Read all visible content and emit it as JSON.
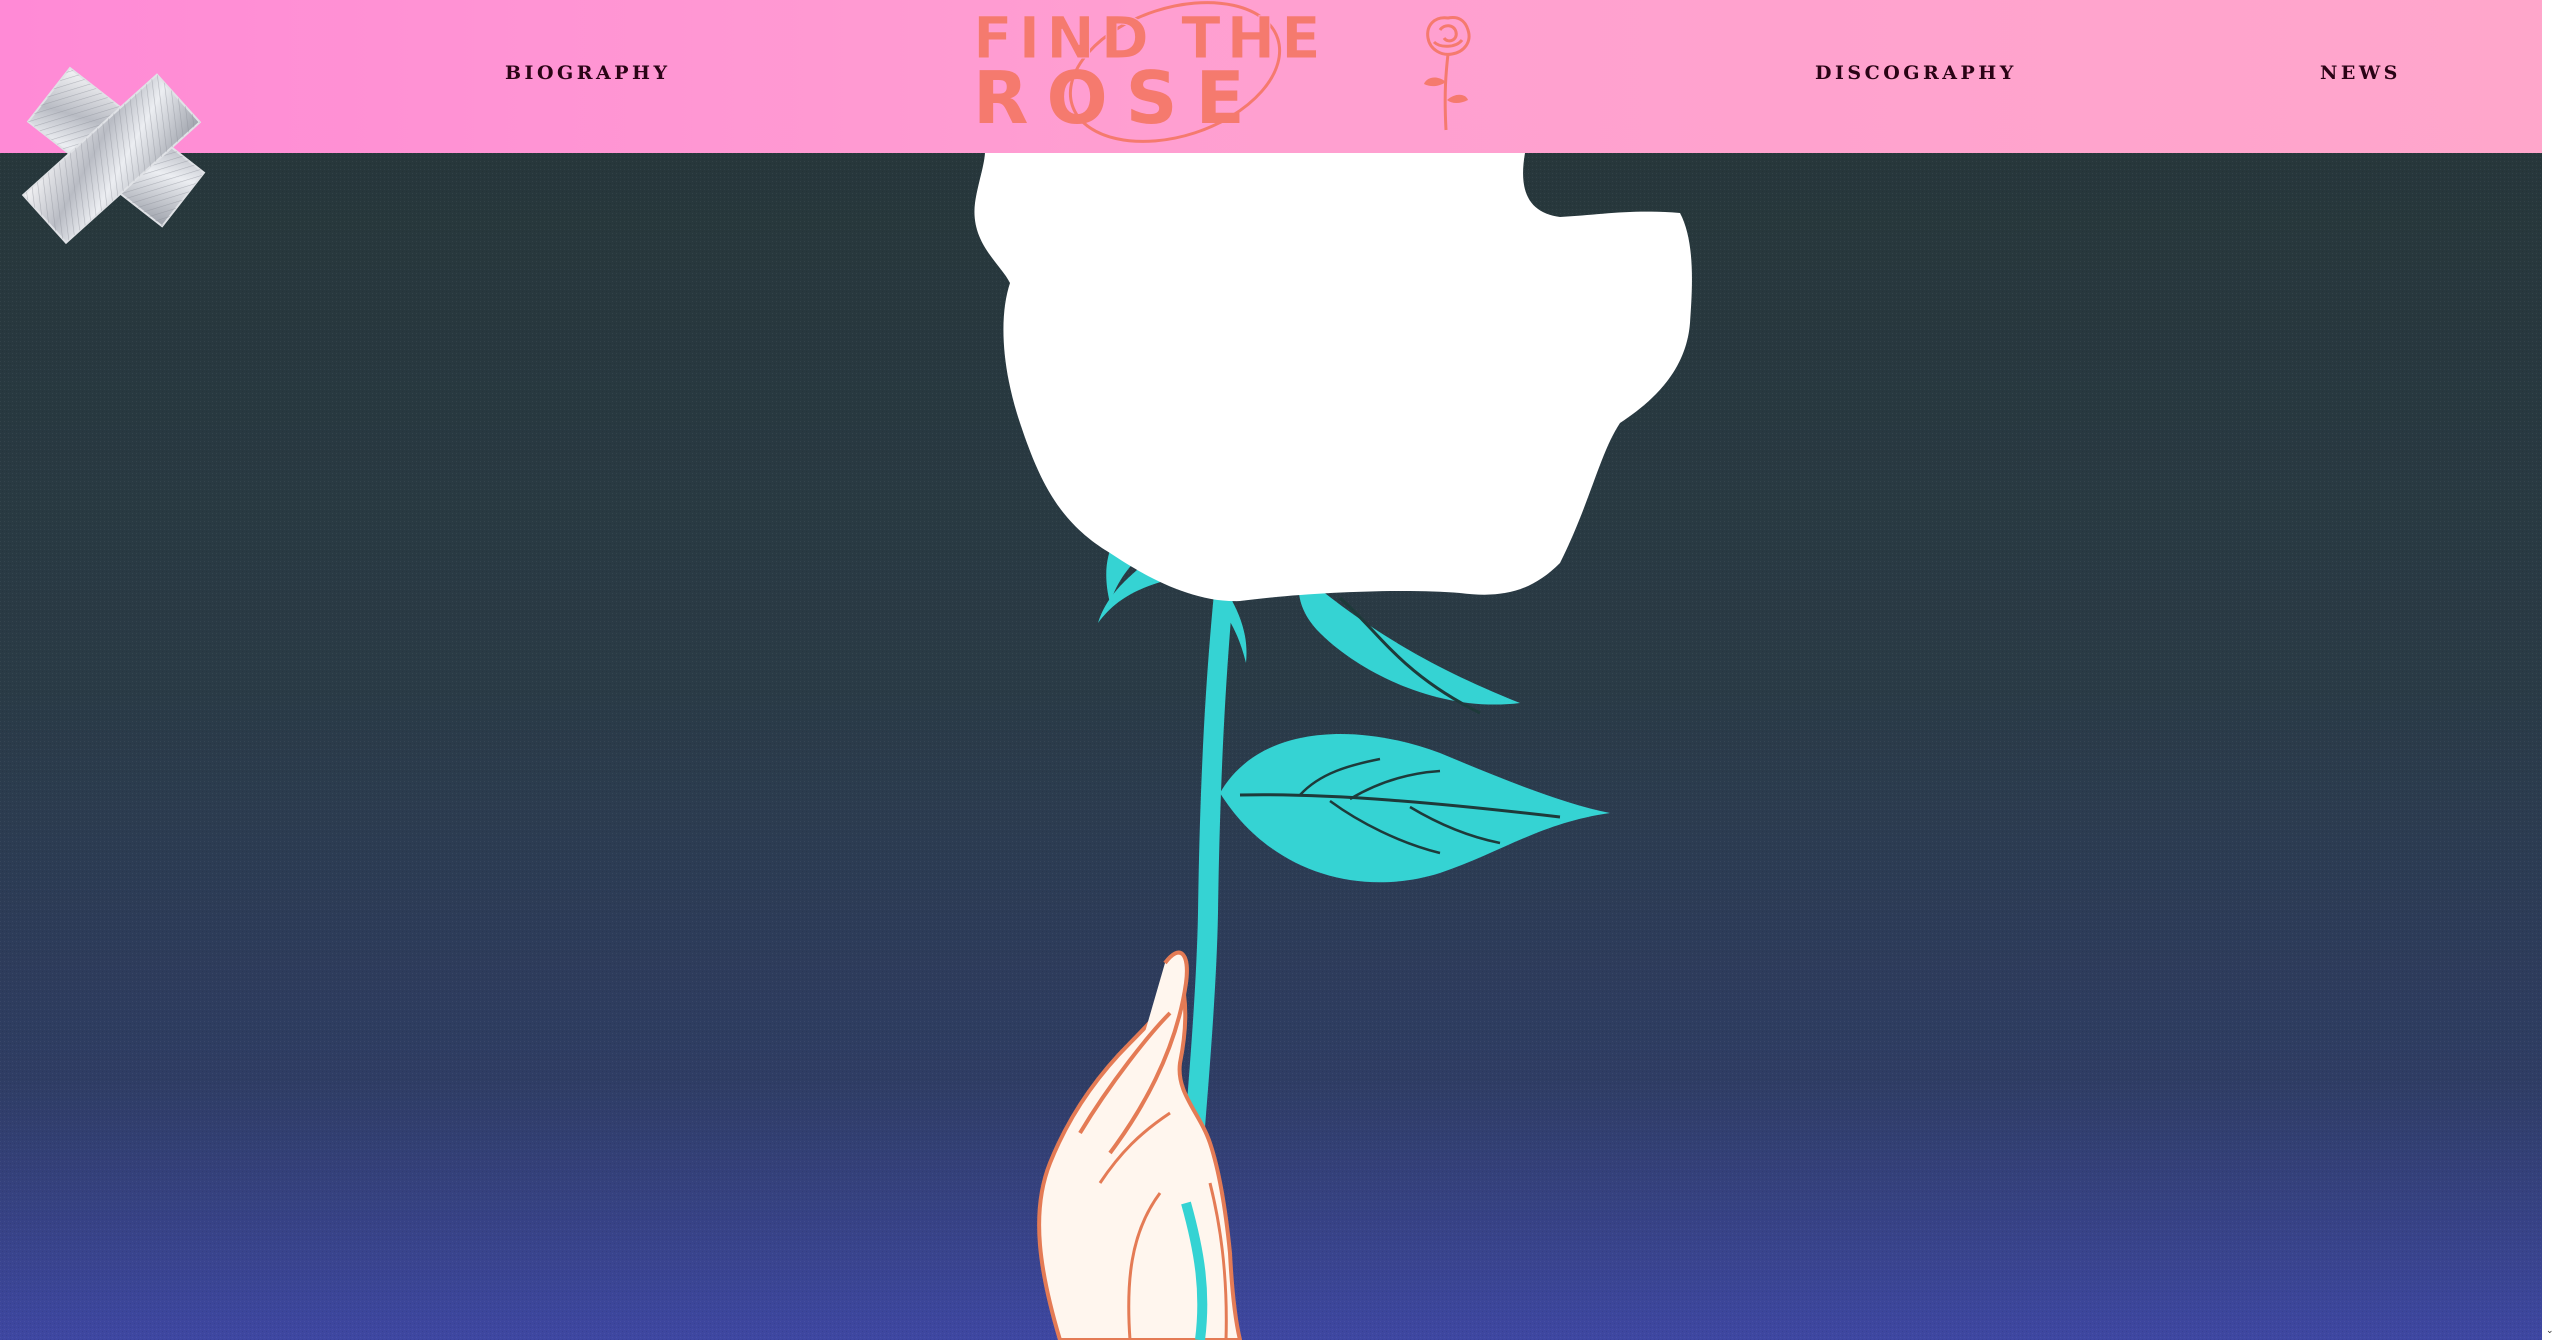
{
  "nav": {
    "biography": "BIOGRAPHY",
    "discography": "DISCOGRAPHY",
    "news": "NEWS"
  },
  "logo": {
    "line1": "FIND THE",
    "line2": "ROSE",
    "alt": "Find The Rose"
  },
  "colors": {
    "header_start": "#ff8ad6",
    "header_end": "#ffa6cb",
    "logo": "#f57a6e",
    "nav_text": "#2a0416",
    "hero_top": "#27373b",
    "hero_bottom": "#3e47a2",
    "stem": "#35d3d3",
    "rose": "#ffffff",
    "skin": "#fff6ee",
    "skin_outline": "#e47b55"
  },
  "icons": {
    "tape": "silver-tape-sticker",
    "rose_mark": "rose-icon",
    "scroll_down": "scroll-down-arrow-icon"
  }
}
